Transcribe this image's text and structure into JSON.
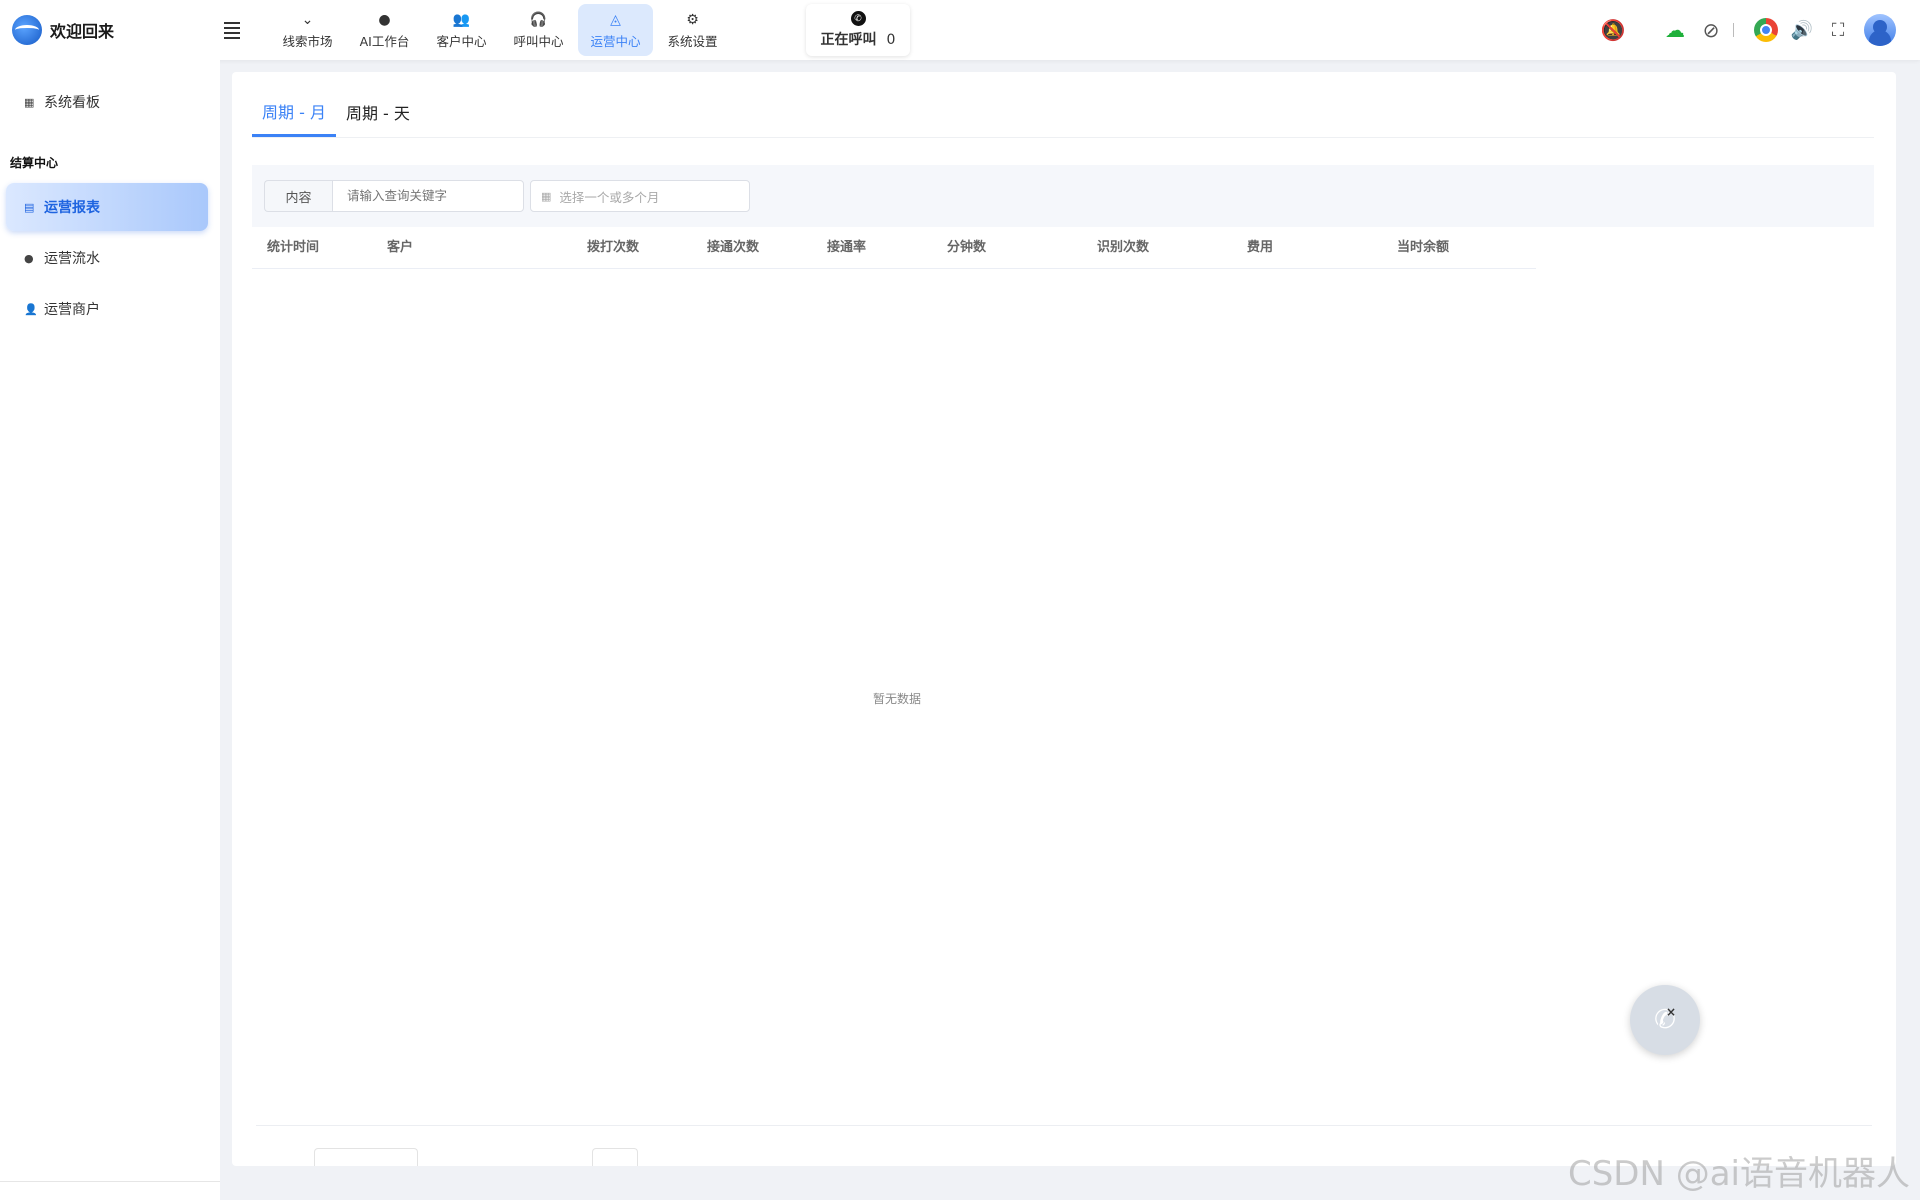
{
  "header": {
    "title": "欢迎回来",
    "nav": [
      {
        "label": "线索市场",
        "icon": "⌄"
      },
      {
        "label": "AI工作台",
        "icon": "●"
      },
      {
        "label": "客户中心",
        "icon": "👥"
      },
      {
        "label": "呼叫中心",
        "icon": "🎧"
      },
      {
        "label": "运营中心",
        "icon": "◬"
      },
      {
        "label": "系统设置",
        "icon": "⚙"
      }
    ],
    "active_nav": "运营中心",
    "calling_label": "正在呼叫",
    "calling_count": "0"
  },
  "sidebar": {
    "top_item": "系统看板",
    "group_title": "结算中心",
    "items": [
      "运营报表",
      "运营流水",
      "运营商户"
    ],
    "active_item": "运营报表"
  },
  "main": {
    "tabs": [
      "周期 - 月",
      "周期 - 天"
    ],
    "active_tab": "周期 - 月",
    "search": {
      "prefix": "内容",
      "placeholder": "请输入查询关键字"
    },
    "month_picker_placeholder": "选择一个或多个月",
    "columns": [
      "统计时间",
      "客户",
      "拨打次数",
      "接通次数",
      "接通率",
      "分钟数",
      "识别次数",
      "费用",
      "当时余额"
    ],
    "empty_text": "暂无数据"
  },
  "colors": {
    "accent": "#3b82f6",
    "bell": "#ff2020",
    "cloud": "#1fb03b"
  },
  "watermark": "CSDN @ai语音机器人"
}
